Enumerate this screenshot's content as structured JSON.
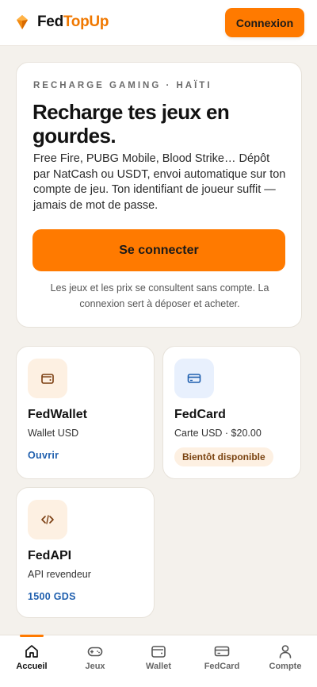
{
  "header": {
    "brand_part1": "Fed",
    "brand_part2": "TopUp",
    "login_label": "Connexion"
  },
  "hero": {
    "eyebrow": "RECHARGE GAMING · HAÏTI",
    "title": "Recharge tes jeux en gourdes.",
    "description": "Free Fire, PUBG Mobile, Blood Strike… Dépôt par NatCash ou USDT, envoi automatique sur ton compte de jeu. Ton identifiant de joueur suffit — jamais de mot de passe.",
    "cta_label": "Se connecter",
    "note": "Les jeux et les prix se consultent sans compte. La connexion sert à déposer et acheter."
  },
  "cards": {
    "wallet": {
      "title": "FedWallet",
      "subtitle": "Wallet USD",
      "link": "Ouvrir",
      "icon": "wallet-icon"
    },
    "fedcard": {
      "title": "FedCard",
      "subtitle": "Carte USD · $20.00",
      "badge": "Bientôt disponible",
      "icon": "credit-card-icon"
    },
    "api": {
      "title": "FedAPI",
      "subtitle": "API revendeur",
      "link": "1500 GDS",
      "icon": "code-icon"
    }
  },
  "nav": {
    "items": [
      {
        "label": "Accueil",
        "icon": "home-icon",
        "active": true
      },
      {
        "label": "Jeux",
        "icon": "gamepad-icon",
        "active": false
      },
      {
        "label": "Wallet",
        "icon": "wallet-icon",
        "active": false
      },
      {
        "label": "FedCard",
        "icon": "credit-card-icon",
        "active": false
      },
      {
        "label": "Compte",
        "icon": "user-icon",
        "active": false
      }
    ]
  },
  "colors": {
    "accent": "#ff7a00",
    "brand_accent": "#f07800",
    "link": "#1f5fae",
    "background": "#f4f1ec"
  }
}
